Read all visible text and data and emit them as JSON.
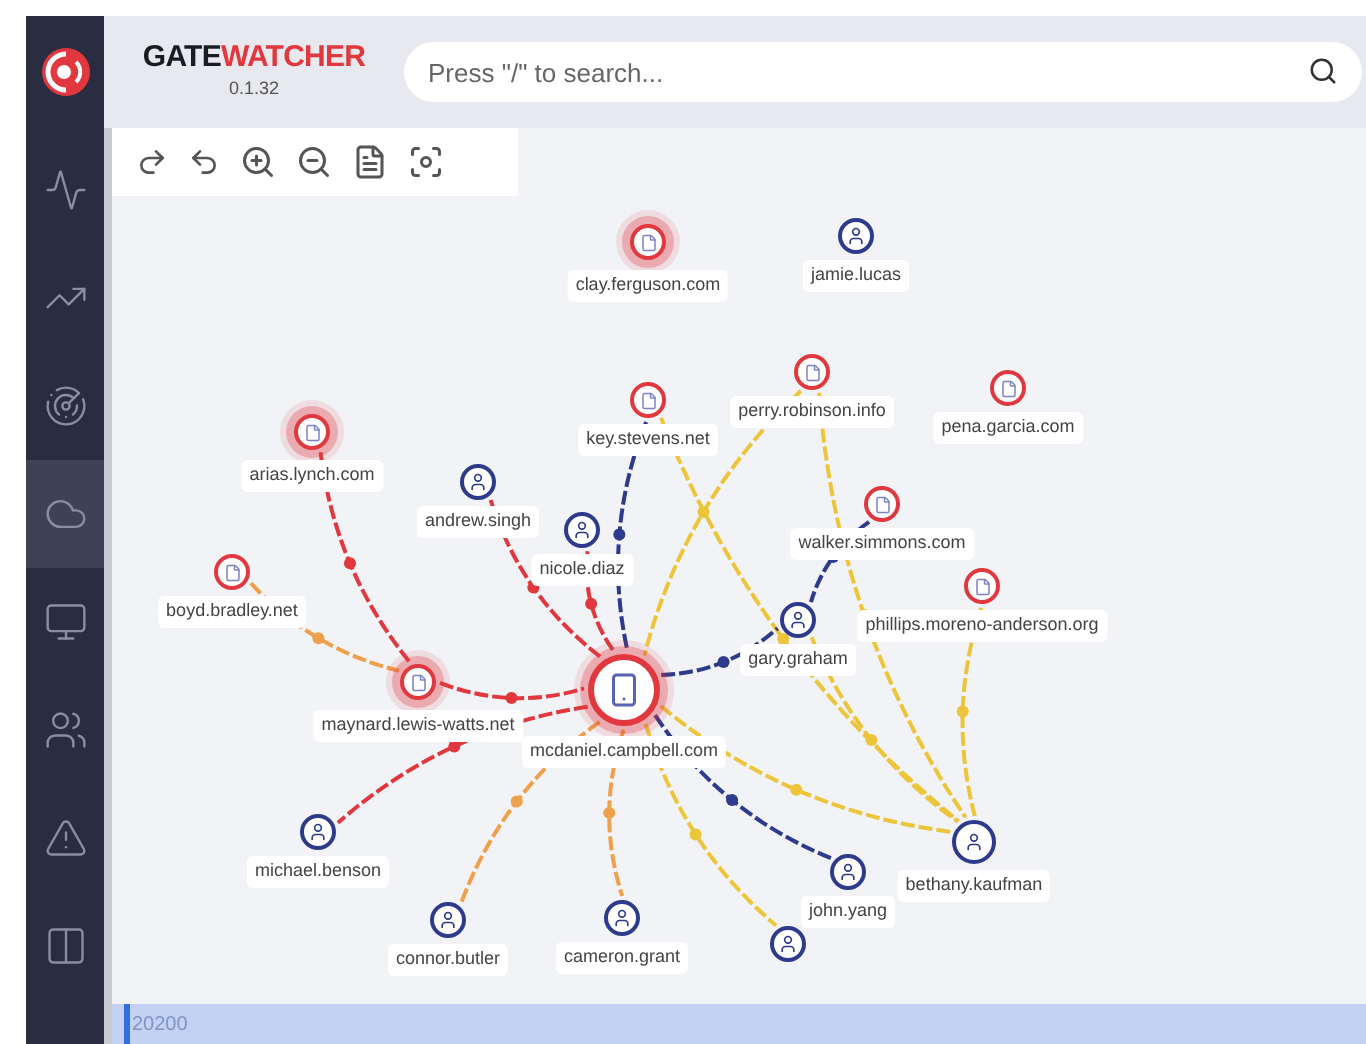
{
  "brand": {
    "name_dark": "GATE",
    "name_accent": "WATCHER",
    "version": "0.1.32"
  },
  "search": {
    "placeholder": "Press \"/\" to search..."
  },
  "sidebar": {
    "items": [
      {
        "selected": false
      },
      {
        "selected": false
      },
      {
        "selected": false
      },
      {
        "selected": true
      },
      {
        "selected": false
      },
      {
        "selected": false
      },
      {
        "selected": false
      },
      {
        "selected": false
      }
    ]
  },
  "graph": {
    "nodes": [
      {
        "kind": "domain",
        "label": "clay.ferguson.com",
        "alert": true
      },
      {
        "kind": "user",
        "label": "jamie.lucas",
        "alert": false
      },
      {
        "kind": "domain",
        "label": "perry.robinson.info",
        "alert": false
      },
      {
        "kind": "domain",
        "label": "pena.garcia.com",
        "alert": false
      },
      {
        "kind": "domain",
        "label": "key.stevens.net",
        "alert": false
      },
      {
        "kind": "domain",
        "label": "arias.lynch.com",
        "alert": true
      },
      {
        "kind": "user",
        "label": "andrew.singh",
        "alert": false
      },
      {
        "kind": "user",
        "label": "nicole.diaz",
        "alert": false
      },
      {
        "kind": "domain",
        "label": "walker.simmons.com",
        "alert": false
      },
      {
        "kind": "domain",
        "label": "boyd.bradley.net",
        "alert": false
      },
      {
        "kind": "domain",
        "label": "phillips.moreno-anderson.org",
        "alert": false
      },
      {
        "kind": "user",
        "label": "gary.graham",
        "alert": false
      },
      {
        "kind": "domain",
        "label": "maynard.lewis-watts.net",
        "alert": true
      },
      {
        "kind": "device",
        "label": "mcdaniel.campbell.com",
        "alert": true
      },
      {
        "kind": "user",
        "label": "michael.benson",
        "alert": false
      },
      {
        "kind": "user",
        "label": "bethany.kaufman",
        "alert": false
      },
      {
        "kind": "user",
        "label": "john.yang",
        "alert": false
      },
      {
        "kind": "user",
        "label": "connor.butler",
        "alert": false
      },
      {
        "kind": "user",
        "label": "cameron.grant",
        "alert": false
      },
      {
        "kind": "user",
        "alert": false
      }
    ],
    "edges": [
      {
        "color": "#e0383e"
      },
      {
        "color": "#eea04a"
      },
      {
        "color": "#e0383e"
      },
      {
        "color": "#e0383e"
      },
      {
        "color": "#e0383e"
      },
      {
        "color": "#2e3a8c"
      },
      {
        "color": "#ecc53a"
      },
      {
        "color": "#ecc53a"
      },
      {
        "color": "#ecc53a"
      },
      {
        "color": "#2e3a8c"
      },
      {
        "color": "#2e3a8c"
      },
      {
        "color": "#ecc53a"
      },
      {
        "color": "#ecc53a"
      },
      {
        "color": "#ecc53a"
      },
      {
        "color": "#e0383e"
      },
      {
        "color": "#eea04a"
      },
      {
        "color": "#eea04a"
      },
      {
        "color": "#ecc53a"
      },
      {
        "color": "#2e3a8c"
      }
    ]
  },
  "timeline": {
    "label": "20200"
  }
}
